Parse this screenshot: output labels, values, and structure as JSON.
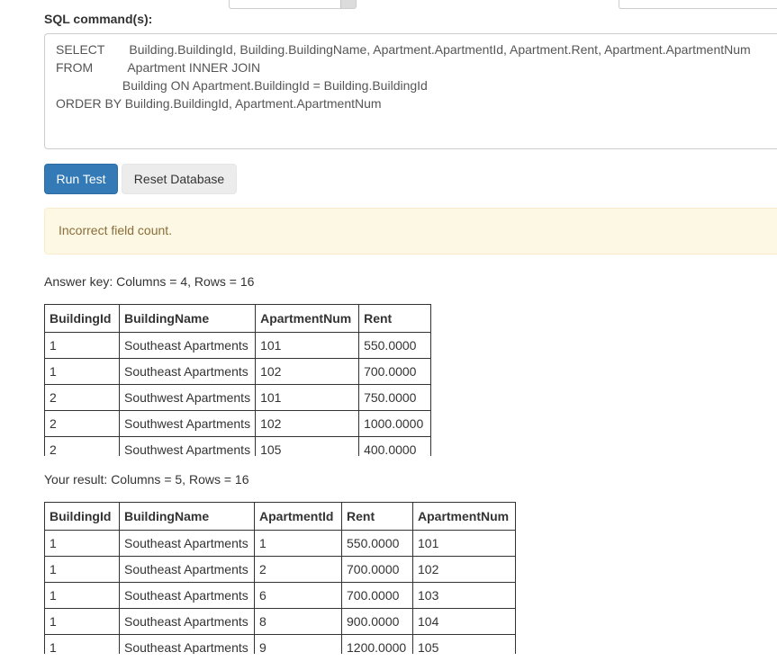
{
  "form": {
    "sql_label": "SQL command(s):",
    "sql_text": "SELECT       Building.BuildingId, Building.BuildingName, Apartment.ApartmentId, Apartment.Rent, Apartment.ApartmentNum\nFROM          Apartment INNER JOIN\n                   Building ON Apartment.BuildingId = Building.BuildingId\nORDER BY Building.BuildingId, Apartment.ApartmentNum"
  },
  "buttons": {
    "run_label": "Run Test",
    "reset_label": "Reset Database"
  },
  "alert": {
    "message": "Incorrect field count."
  },
  "answer_key": {
    "caption": "Answer key: Columns = 4, Rows = 16",
    "headers": [
      "BuildingId",
      "BuildingName",
      "ApartmentNum",
      "Rent"
    ],
    "rows": [
      [
        "1",
        "Southeast Apartments",
        "101",
        "550.0000"
      ],
      [
        "1",
        "Southeast Apartments",
        "102",
        "700.0000"
      ],
      [
        "2",
        "Southwest Apartments",
        "101",
        "750.0000"
      ],
      [
        "2",
        "Southwest Apartments",
        "102",
        "1000.0000"
      ],
      [
        "2",
        "Southwest Apartments",
        "105",
        "400.0000"
      ]
    ]
  },
  "your_result": {
    "caption": "Your result: Columns = 5, Rows = 16",
    "headers": [
      "BuildingId",
      "BuildingName",
      "ApartmentId",
      "Rent",
      "ApartmentNum"
    ],
    "rows": [
      [
        "1",
        "Southeast Apartments",
        "1",
        "550.0000",
        "101"
      ],
      [
        "1",
        "Southeast Apartments",
        "2",
        "700.0000",
        "102"
      ],
      [
        "1",
        "Southeast Apartments",
        "6",
        "700.0000",
        "103"
      ],
      [
        "1",
        "Southeast Apartments",
        "8",
        "900.0000",
        "104"
      ],
      [
        "1",
        "Southeast Apartments",
        "9",
        "1200.0000",
        "105"
      ]
    ]
  }
}
